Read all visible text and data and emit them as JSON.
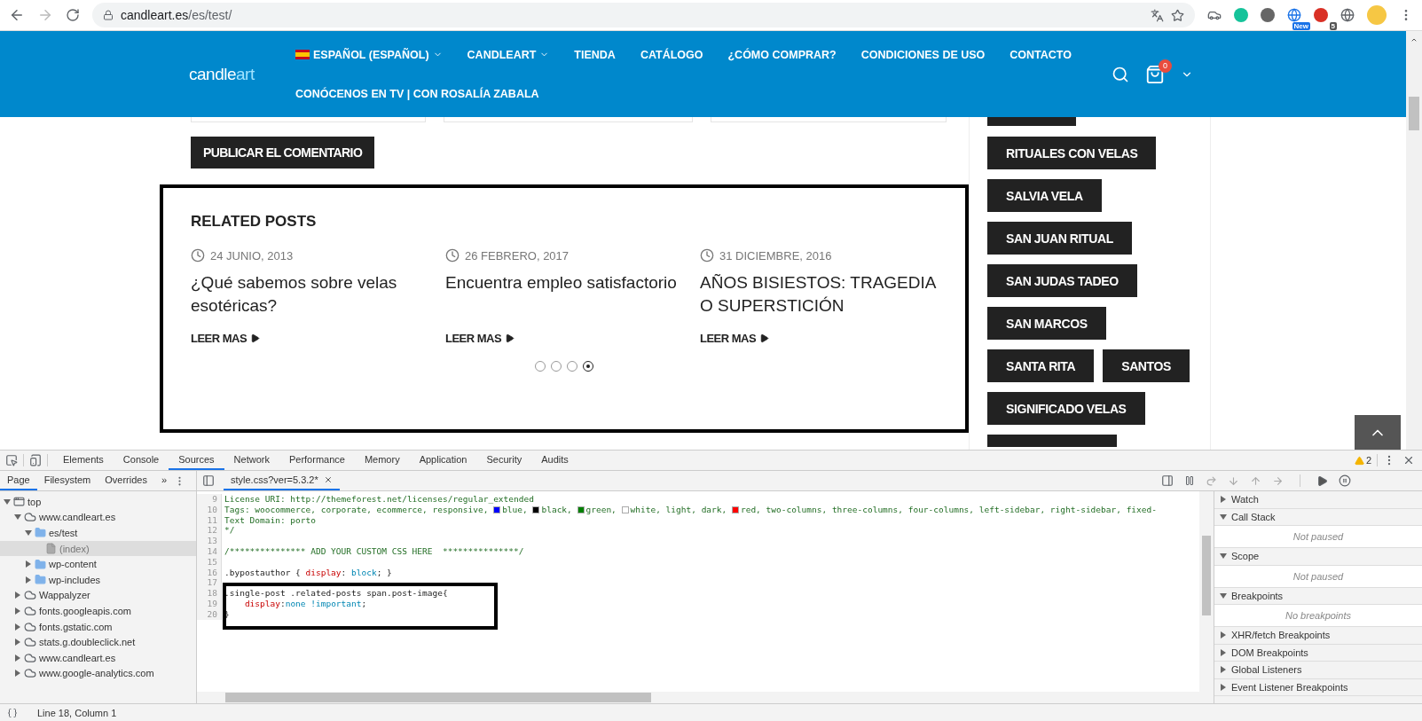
{
  "browser": {
    "url_host": "candleart.es",
    "url_path": "/es/test/",
    "badges": [
      {
        "text": "New",
        "kind": "new"
      },
      {
        "text": "5",
        "kind": "count"
      }
    ]
  },
  "header": {
    "logo_main": "candle",
    "logo_accent": "art",
    "cart_count": "0",
    "nav_rows": [
      [
        {
          "label": "ESPAÑOL (ESPAÑOL)",
          "kind": "language",
          "dropdown": true
        },
        {
          "label": "CANDLEART",
          "kind": "link",
          "dropdown": true
        },
        {
          "label": "TIENDA",
          "kind": "link",
          "dropdown": false
        },
        {
          "label": "CATÁLOGO",
          "kind": "link",
          "dropdown": false
        },
        {
          "label": "¿CÓMO COMPRAR?",
          "kind": "link",
          "dropdown": false
        },
        {
          "label": "CONDICIONES DE USO",
          "kind": "link",
          "dropdown": false
        },
        {
          "label": "CONTACTO",
          "kind": "link",
          "dropdown": false
        }
      ],
      [
        {
          "label": "CONÓCENOS EN TV | CON ROSALÍA ZABALA",
          "kind": "link",
          "dropdown": false
        }
      ]
    ]
  },
  "comment_form": {
    "submit": "PUBLICAR EL COMENTARIO"
  },
  "related": {
    "title_light": "RELATED",
    "title_bold": "POSTS",
    "posts": [
      {
        "date": "24 JUNIO, 2013",
        "title": "¿Qué sabemos sobre velas esotéricas?",
        "more": "LEER MAS"
      },
      {
        "date": "26 FEBRERO, 2017",
        "title": "Encuentra empleo satisfactorio",
        "more": "LEER MAS"
      },
      {
        "date": "31 DICIEMBRE, 2016",
        "title": "AÑOS BISIESTOS: TRAGEDIA O SUPERSTICIÓN",
        "more": "LEER MAS"
      }
    ],
    "dots": [
      {
        "selected": false
      },
      {
        "selected": false
      },
      {
        "selected": false
      },
      {
        "selected": true
      }
    ]
  },
  "sidebar": {
    "tag_rows": [
      [
        "RITUALES CON VELAS"
      ],
      [
        "SALVIA VELA"
      ],
      [
        "SAN JUAN RITUAL"
      ],
      [
        "SAN JUDAS TADEO"
      ],
      [
        "SAN MARCOS"
      ],
      [
        "SANTA RITA",
        "SANTOS"
      ],
      [
        "SIGNIFICADO VELAS"
      ]
    ]
  },
  "devtools": {
    "main_tabs": [
      {
        "label": "Elements",
        "selected": false
      },
      {
        "label": "Console",
        "selected": false
      },
      {
        "label": "Sources",
        "selected": true
      },
      {
        "label": "Network",
        "selected": false
      },
      {
        "label": "Performance",
        "selected": false
      },
      {
        "label": "Memory",
        "selected": false
      },
      {
        "label": "Application",
        "selected": false
      },
      {
        "label": "Security",
        "selected": false
      },
      {
        "label": "Audits",
        "selected": false
      }
    ],
    "warnings": "2",
    "nav_tabs": [
      {
        "label": "Page",
        "selected": true
      },
      {
        "label": "Filesystem",
        "selected": false
      },
      {
        "label": "Overrides",
        "selected": false
      }
    ],
    "more_tabs": "»",
    "tree": [
      {
        "label": "top",
        "kind": "frame",
        "expanded": true,
        "selected": false,
        "children": [
          {
            "label": "www.candleart.es",
            "kind": "domain",
            "expanded": true,
            "selected": false,
            "children": [
              {
                "label": "es/test",
                "kind": "folder",
                "expanded": true,
                "selected": false,
                "children": [
                  {
                    "label": "(index)",
                    "kind": "file",
                    "selected": true
                  }
                ]
              },
              {
                "label": "wp-content",
                "kind": "folder",
                "expanded": false,
                "selected": false
              },
              {
                "label": "wp-includes",
                "kind": "folder",
                "expanded": false,
                "selected": false
              }
            ]
          },
          {
            "label": "Wappalyzer",
            "kind": "domain",
            "expanded": false,
            "selected": false
          },
          {
            "label": "fonts.googleapis.com",
            "kind": "domain",
            "expanded": false,
            "selected": false
          },
          {
            "label": "fonts.gstatic.com",
            "kind": "domain",
            "expanded": false,
            "selected": false
          },
          {
            "label": "stats.g.doubleclick.net",
            "kind": "domain",
            "expanded": false,
            "selected": false
          },
          {
            "label": "www.candleart.es",
            "kind": "domain",
            "expanded": false,
            "selected": false
          },
          {
            "label": "www.google-analytics.com",
            "kind": "domain",
            "expanded": false,
            "selected": false
          }
        ]
      }
    ],
    "file_tab": "style.css?ver=5.3.2*",
    "code_lines": [
      {
        "number": "9",
        "highlighted": false,
        "tokens": [
          {
            "kind": "comment",
            "text": "License URI: http://themeforest.net/licenses/regular_extended"
          }
        ]
      },
      {
        "number": "10",
        "highlighted": false,
        "tokens": [
          {
            "kind": "comment",
            "text": "Tags: woocommerce, corporate, ecommerce, responsive, "
          },
          {
            "kind": "swatch",
            "color": "#0000ff"
          },
          {
            "kind": "comment",
            "text": "blue, "
          },
          {
            "kind": "swatch",
            "color": "#000000"
          },
          {
            "kind": "comment",
            "text": "black, "
          },
          {
            "kind": "swatch",
            "color": "#008000"
          },
          {
            "kind": "comment",
            "text": "green, "
          },
          {
            "kind": "swatch",
            "color": "#ffffff"
          },
          {
            "kind": "comment",
            "text": "white, light, dark, "
          },
          {
            "kind": "swatch",
            "color": "#ff0000"
          },
          {
            "kind": "comment",
            "text": "red, two-columns, three-columns, four-columns, left-sidebar, right-sidebar, fixed-"
          }
        ]
      },
      {
        "number": "11",
        "highlighted": false,
        "tokens": [
          {
            "kind": "comment",
            "text": "Text Domain: porto"
          }
        ]
      },
      {
        "number": "12",
        "highlighted": false,
        "tokens": [
          {
            "kind": "comment",
            "text": "*/"
          }
        ]
      },
      {
        "number": "13",
        "highlighted": false
      },
      {
        "number": "14",
        "highlighted": false,
        "tokens": [
          {
            "kind": "comment",
            "text": "/*************** ADD YOUR CUSTOM CSS HERE  ***************/"
          }
        ]
      },
      {
        "number": "15",
        "highlighted": false
      },
      {
        "number": "16",
        "highlighted": false,
        "tokens": [
          {
            "kind": "plain",
            "text": ".bypostauthor { "
          },
          {
            "kind": "property",
            "text": "display"
          },
          {
            "kind": "plain",
            "text": ": "
          },
          {
            "kind": "value",
            "text": "block"
          },
          {
            "kind": "plain",
            "text": "; }"
          }
        ]
      },
      {
        "number": "17",
        "highlighted": false
      },
      {
        "number": "18",
        "highlighted": true,
        "tokens": [
          {
            "kind": "plain",
            "text": ".single-post .related-posts span.post-image{"
          }
        ]
      },
      {
        "number": "19",
        "highlighted": true,
        "tokens": [
          {
            "kind": "indent"
          },
          {
            "kind": "property",
            "text": "display"
          },
          {
            "kind": "plain",
            "text": ":"
          },
          {
            "kind": "value",
            "text": "none !important"
          },
          {
            "kind": "plain",
            "text": ";"
          }
        ]
      },
      {
        "number": "20",
        "highlighted": true,
        "tokens": [
          {
            "kind": "plain",
            "text": "}"
          }
        ]
      }
    ],
    "debug_sections": [
      {
        "label": "Watch",
        "expanded": false
      },
      {
        "label": "Call Stack",
        "expanded": true,
        "body": "Not paused"
      },
      {
        "label": "Scope",
        "expanded": true,
        "body": "Not paused"
      },
      {
        "label": "Breakpoints",
        "expanded": true,
        "body": "No breakpoints"
      },
      {
        "label": "XHR/fetch Breakpoints",
        "expanded": false
      },
      {
        "label": "DOM Breakpoints",
        "expanded": false
      },
      {
        "label": "Global Listeners",
        "expanded": false
      },
      {
        "label": "Event Listener Breakpoints",
        "expanded": false
      }
    ],
    "status": "Line 18, Column 1"
  }
}
